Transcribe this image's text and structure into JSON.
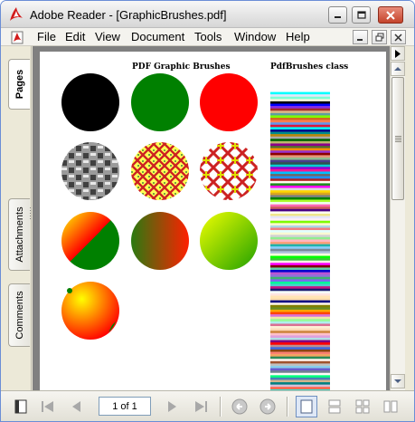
{
  "window": {
    "title": "Adobe Reader - [GraphicBrushes.pdf]"
  },
  "menu": {
    "items": [
      "File",
      "Edit",
      "View",
      "Document",
      "Tools",
      "Window",
      "Help"
    ]
  },
  "nav_tabs": [
    "Pages",
    "Attachments",
    "Comments"
  ],
  "document": {
    "heading_left": "PDF Graphic Brushes",
    "heading_right": "PdfBrushes class",
    "stripe_colors": [
      "#ffffff",
      "#00ffff",
      "#e6e6fa",
      "#7fffd4",
      "#f5f5dc",
      "#000000",
      "#0000ff",
      "#8a2be2",
      "#a52a2a",
      "#deb887",
      "#5f9ea0",
      "#7fff00",
      "#d2691e",
      "#ff7f50",
      "#6495ed",
      "#dc143c",
      "#00ffff",
      "#00008b",
      "#008b8b",
      "#b8860b",
      "#a9a9a9",
      "#006400",
      "#bdb76b",
      "#8b008b",
      "#556b2f",
      "#ff8c00",
      "#9932cc",
      "#8b0000",
      "#e9967a",
      "#8fbc8f",
      "#483d8b",
      "#2f4f4f",
      "#00ced1",
      "#9400d3",
      "#ff1493",
      "#00bfff",
      "#696969",
      "#1e90ff",
      "#b22222",
      "#fffaf0",
      "#228b22",
      "#ff00ff",
      "#dcdcdc",
      "#ffd700",
      "#daa520",
      "#808080",
      "#008000",
      "#adff2f",
      "#f0fff0",
      "#ff69b4",
      "#cd5c5c",
      "#4b0082",
      "#fffff0",
      "#f0e68c",
      "#e6e6fa",
      "#fff0f5",
      "#7cfc00",
      "#fffacd",
      "#add8e6",
      "#f08080",
      "#e0ffff",
      "#fafad2",
      "#d3d3d3",
      "#90ee90",
      "#ffb6c1",
      "#ffa07a",
      "#20b2aa",
      "#87cefa",
      "#778899",
      "#b0c4de",
      "#ffffe0",
      "#00ff00",
      "#32cd32",
      "#faf0e6",
      "#ff00ff",
      "#800000",
      "#66cdaa",
      "#0000cd",
      "#ba55d3",
      "#9370db",
      "#3cb371",
      "#7b68ee",
      "#00fa9a",
      "#48d1cc",
      "#c71585",
      "#191970",
      "#f5fffa",
      "#ffe4e1",
      "#ffe4b5",
      "#ffdead",
      "#000080",
      "#fdf5e6",
      "#808000",
      "#6b8e23",
      "#ffa500",
      "#ff4500",
      "#da70d6",
      "#eee8aa",
      "#98fb98",
      "#afeeee",
      "#db7093",
      "#ffefd5",
      "#ffdab9",
      "#cd853f",
      "#ffc0cb",
      "#dda0dd",
      "#b0e0e6",
      "#800080",
      "#ff0000",
      "#bc8f8f",
      "#4169e1",
      "#8b4513",
      "#fa8072",
      "#f4a460",
      "#2e8b57",
      "#fff5ee",
      "#a0522d",
      "#c0c0c0",
      "#87ceeb",
      "#6a5acd",
      "#708090",
      "#fffafa",
      "#00ff7f",
      "#4682b4",
      "#d2b48c",
      "#008080",
      "#d8bfd8",
      "#ff6347",
      "#40e0d0",
      "#ee82ee"
    ]
  },
  "toolbar": {
    "page_indicator": "1 of 1"
  }
}
